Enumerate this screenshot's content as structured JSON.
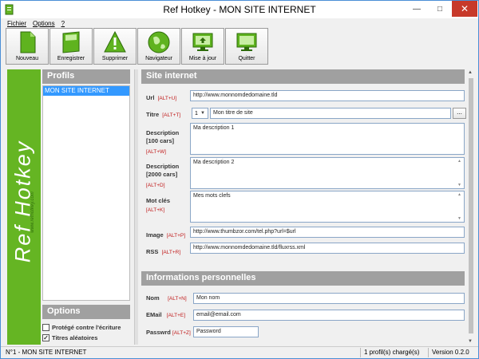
{
  "window": {
    "title": "Ref Hotkey - MON SITE INTERNET"
  },
  "menu": [
    "Fichier",
    "Options",
    "?"
  ],
  "toolbar": [
    {
      "label": "Nouveau",
      "icon": "new-file-icon"
    },
    {
      "label": "Enregistrer",
      "icon": "save-icon"
    },
    {
      "label": "Supprimer",
      "icon": "warning-icon"
    },
    {
      "label": "Navigateur",
      "icon": "globe-icon"
    },
    {
      "label": "Mise à jour",
      "icon": "monitor-update-icon"
    },
    {
      "label": "Quitter",
      "icon": "monitor-exit-icon"
    }
  ],
  "brand": {
    "name": "Ref Hotkey",
    "url": "www.refhotkey.com",
    "color": "#65b523"
  },
  "profiles": {
    "heading": "Profils",
    "items": [
      "MON SITE INTERNET"
    ],
    "selected_color": "#3399ff"
  },
  "options": {
    "heading": "Options",
    "protect": {
      "label": "Protégé contre l'écriture",
      "checked": false
    },
    "random_titles": {
      "label": "Titres aléatoires",
      "checked": true
    }
  },
  "site": {
    "heading": "Site internet",
    "url": {
      "label": "Url",
      "shortcut": "[ALT+U]",
      "value": "http://www.monnomdedomaine.tld"
    },
    "titre": {
      "label": "Titre",
      "shortcut": "[ALT+T]",
      "index": "1",
      "value": "Mon titre de site",
      "more_button": "..."
    },
    "desc100": {
      "label": "Description",
      "label2": "[100 cars]",
      "shortcut": "[ALT+W]",
      "value": "Ma description 1"
    },
    "desc2000": {
      "label": "Description",
      "label2": "[2000 cars]",
      "shortcut": "[ALT+D]",
      "value": "Ma description 2"
    },
    "keywords": {
      "label": "Mot clés",
      "shortcut": "[ALT+K]",
      "value": "Mes mots clefs"
    },
    "image": {
      "label": "Image",
      "shortcut": "[ALT+P]",
      "value": "http://www.thumbzor.com/tel.php?url=$url"
    },
    "rss": {
      "label": "RSS",
      "shortcut": "[ALT+R]",
      "value": "http://www.monnomdedomaine.tld/fluxrss.xml"
    }
  },
  "perso": {
    "heading": "Informations personnelles",
    "nom": {
      "label": "Nom",
      "shortcut": "[ALT+N]",
      "value": "Mon nom"
    },
    "email": {
      "label": "EMail",
      "shortcut": "[ALT+E]",
      "value": "email@email.com"
    },
    "password": {
      "label": "Passwrd",
      "shortcut": "[ALT+Z]",
      "value": "Password"
    }
  },
  "status": {
    "profile": "N°1 - MON SITE INTERNET",
    "loaded": "1 profil(s) chargé(s)",
    "version": "Version 0.2.0"
  },
  "colors": {
    "section_header": "#a0a0a0",
    "shortcut": "#c01818",
    "close_button": "#c7392a"
  }
}
